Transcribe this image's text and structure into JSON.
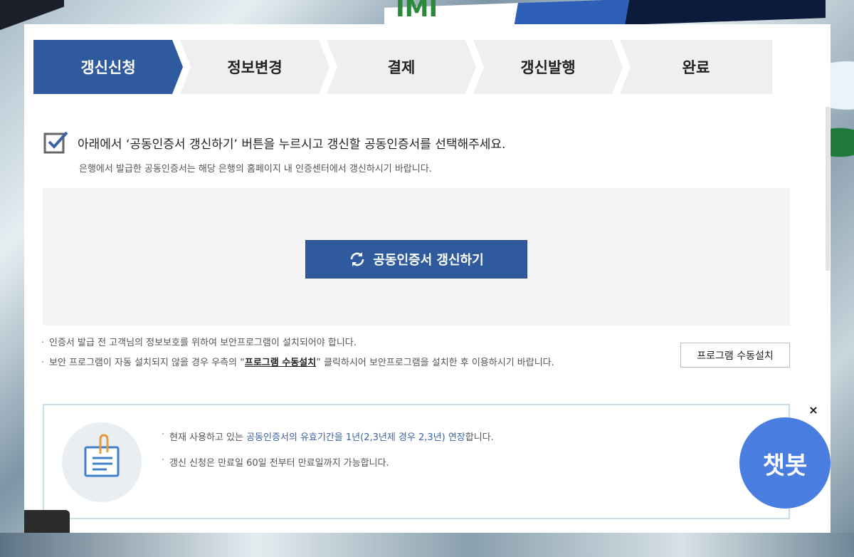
{
  "steps": [
    {
      "label": "갱신신청",
      "active": true
    },
    {
      "label": "정보변경",
      "active": false
    },
    {
      "label": "결제",
      "active": false
    },
    {
      "label": "갱신발행",
      "active": false
    },
    {
      "label": "완료",
      "active": false
    }
  ],
  "notice": {
    "title": "아래에서 ‘공동인증서 갱신하기’ 버튼을 누르시고 갱신할 공동인증서를 선택해주세요.",
    "subtitle": "은행에서 발급한 공동인증서는 해당 은행의 홈페이지 내 인증센터에서 갱신하시기 바랍니다."
  },
  "renew_button": {
    "label": "공동인증서 갱신하기",
    "icon": "refresh-icon"
  },
  "bullets": {
    "item1": "인증서 발급 전 고객님의 정보보호를 위하여 보안프로그램이 설치되어야 합니다.",
    "item2_prefix": "보안 프로그램이 자동 설치되지 않을 경우 우측의 “",
    "item2_link": "프로그램 수동설치",
    "item2_suffix": "” 클릭하시어 보안프로그램을 설치한 후 이용하시기 바랍니다."
  },
  "manual_install_button": "프로그램 수동설치",
  "info": {
    "item1_prefix": "현재 사용하고 있는 ",
    "item1_highlight": "공동인증서의 유효기간을 1년(2,3년제 경우 2,3년) 연장",
    "item1_suffix": "합니다.",
    "item2": "갱신 신청은 만료일 60일 전부터 만료일까지 가능합니다."
  },
  "chatbot": {
    "label": "챗봇",
    "close": "×"
  },
  "background": {
    "text": "IMI"
  },
  "colors": {
    "primary": "#2f5a9e",
    "chatbot": "#4a7de0",
    "info_border": "#c8dde8"
  }
}
